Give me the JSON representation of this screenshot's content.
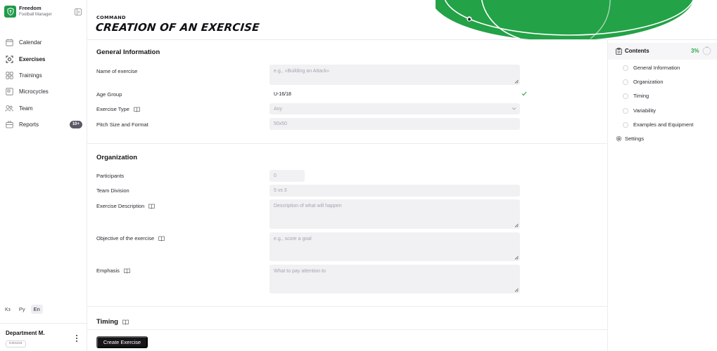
{
  "brand": {
    "name": "Freedom",
    "subtitle": "Football Manager"
  },
  "nav": [
    {
      "label": "Calendar",
      "icon": "calendar-icon"
    },
    {
      "label": "Exercises",
      "icon": "exercises-icon",
      "active": true
    },
    {
      "label": "Trainings",
      "icon": "grid-icon"
    },
    {
      "label": "Microcycles",
      "icon": "microcycle-icon"
    },
    {
      "label": "Team",
      "icon": "team-icon"
    },
    {
      "label": "Reports",
      "icon": "reports-icon",
      "badge": "10+"
    }
  ],
  "languages": [
    "Кз",
    "Ру",
    "En"
  ],
  "selected_language": "En",
  "user": {
    "name": "Department M.",
    "role": "COACH"
  },
  "header": {
    "subtitle": "COMMAND",
    "title": "CREATION OF AN EXERCISE"
  },
  "sections": {
    "general": {
      "title": "General Information",
      "name_label": "Name of exercise",
      "name_placeholder": "e.g., «Building an Attack»",
      "age_label": "Age Group",
      "age_value": "U-16/18",
      "type_label": "Exercise Type",
      "type_placeholder": "Any",
      "pitch_label": "Pitch Size and Format",
      "pitch_placeholder": "50x50"
    },
    "organization": {
      "title": "Organization",
      "participants_label": "Participants",
      "participants_placeholder": "0",
      "division_label": "Team Division",
      "division_placeholder": "5 vs 3",
      "description_label": "Exercise Description",
      "description_placeholder": "Description of what will happen",
      "objective_label": "Objective of the exercise",
      "objective_placeholder": "e.g., score a goal",
      "emphasis_label": "Emphasis",
      "emphasis_placeholder": "What to pay attention to"
    },
    "timing": {
      "title": "Timing"
    }
  },
  "submit_label": "Create Exercise",
  "contents": {
    "title": "Contents",
    "progress": "3%",
    "progress_fraction": 0.03,
    "items": [
      "General Information",
      "Organization",
      "Timing",
      "Variability",
      "Examples and Equipment"
    ],
    "settings_label": "Settings"
  },
  "colors": {
    "accent": "#2aa84a",
    "pitch": "#23a247",
    "dark": "#15151a"
  }
}
